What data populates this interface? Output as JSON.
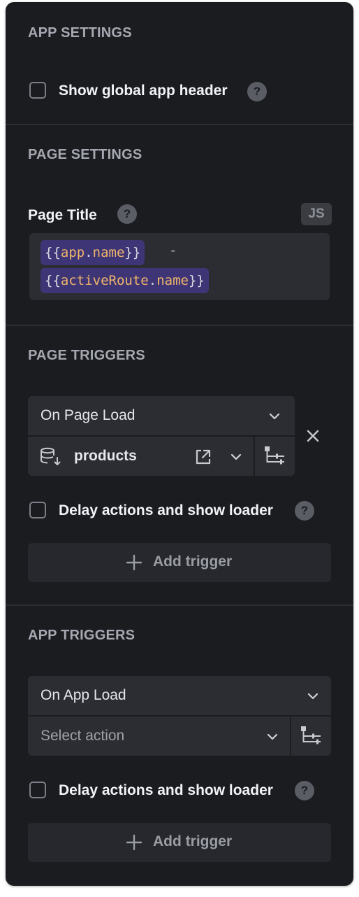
{
  "app_settings": {
    "title": "APP SETTINGS",
    "show_header_label": "Show global app header",
    "help_glyph": "?"
  },
  "page_settings": {
    "title": "PAGE SETTINGS",
    "page_title_label": "Page Title",
    "js_badge": "JS",
    "code_line1_open": "{{",
    "code_line1_obj": "app",
    "code_line1_dot": ".",
    "code_line1_prop": "name",
    "code_line1_close": "}}",
    "code_separator": "-",
    "code_line2_open": "{{",
    "code_line2_obj": "activeRoute",
    "code_line2_dot": ".",
    "code_line2_prop": "name",
    "code_line2_close": "}}"
  },
  "page_triggers": {
    "title": "PAGE TRIGGERS",
    "event": "On Page Load",
    "action": "products",
    "delay_label": "Delay actions and show loader",
    "add_trigger": "Add trigger"
  },
  "app_triggers": {
    "title": "APP TRIGGERS",
    "event": "On App Load",
    "action_placeholder": "Select action",
    "delay_label": "Delay actions and show loader",
    "add_trigger": "Add trigger"
  },
  "colors": {
    "panel_bg": "#1b1c20",
    "field_bg": "#2b2d33",
    "chip_bg": "#3e3577",
    "code_identifier": "#f0b56a",
    "section_title": "#a5a8b0"
  },
  "icons": {
    "help": "question-circle-icon",
    "chevron": "chevron-down-icon",
    "close": "close-icon",
    "query": "database-icon",
    "open": "external-link-icon",
    "settings": "sliders-icon",
    "add": "plus-icon"
  }
}
